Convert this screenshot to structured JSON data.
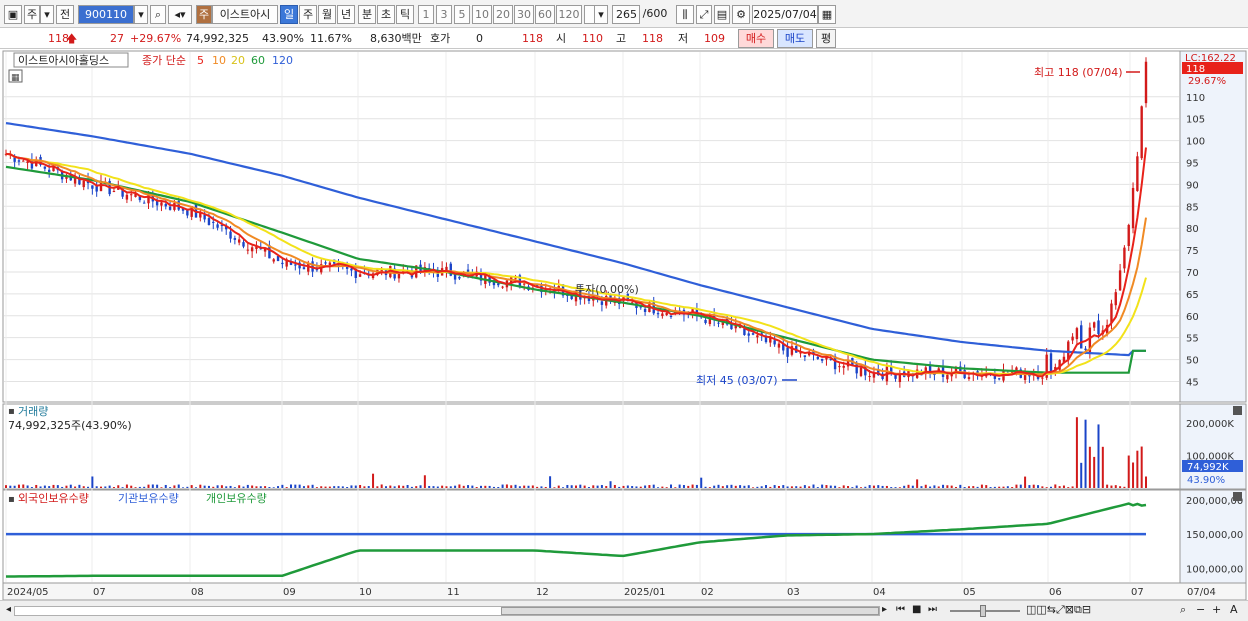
{
  "toolbar": {
    "market": "주",
    "prev_label": "전",
    "code": "900110",
    "tab_stock": "주",
    "stock_name": "이스트아시",
    "periods": [
      "일",
      "주",
      "월",
      "년",
      "분",
      "초",
      "틱"
    ],
    "active_period": "일",
    "intervals": [
      "1",
      "3",
      "5",
      "10",
      "20",
      "30",
      "60",
      "120"
    ],
    "bar_count": "265",
    "bar_total": "/600",
    "date": "2025/07/04"
  },
  "quote": {
    "price": "118",
    "change": "27",
    "change_pct": "+29.67%",
    "volume": "74,992,325",
    "vol_ratio": "43.90%",
    "turnover": "11.67%",
    "amount": "8,630백만",
    "hoga_label": "호가",
    "hoga_value": "0",
    "ask": "118",
    "open_label": "시",
    "open": "110",
    "high_label": "고",
    "high": "118",
    "low_label": "저",
    "low": "109",
    "buy_label": "매수",
    "sell_label": "매도",
    "avg_label": "평"
  },
  "colors": {
    "up": "#d21a1a",
    "down": "#1a44c8",
    "ma5": "#e8221a",
    "ma10": "#f08a24",
    "ma20": "#f2e21a",
    "ma60": "#1f9a3a",
    "ma120": "#2f5fd8"
  },
  "price_panel": {
    "stock_label": "이스트아시아홀딩스",
    "ma_label": "종가 단순",
    "ma_periods": [
      "5",
      "10",
      "20",
      "60",
      "120"
    ],
    "high_marker": "최고 118 (07/04)",
    "low_marker": "최저 45 (03/07)",
    "zero_label": "투자(0.00%)",
    "price_tag": "118",
    "pct_tag": "29.67%",
    "lc_tag": "LC:162.22"
  },
  "volume_panel": {
    "title": "거래량",
    "value_text": "74,992,325주(43.90%)",
    "tag_value": "74,992K",
    "tag_pct": "43.90%"
  },
  "holdings_panel": {
    "legend": [
      "외국인보유수량",
      "기관보유수량",
      "개인보유수량"
    ]
  },
  "chart_data": [
    {
      "type": "line",
      "name": "price",
      "x": [
        "2024/05",
        "06",
        "07",
        "08",
        "09",
        "10",
        "11",
        "12",
        "2025/01",
        "02",
        "03",
        "04",
        "05",
        "06",
        "07"
      ],
      "close": [
        97,
        90,
        84,
        72,
        70,
        70,
        67,
        63,
        60,
        52,
        47,
        47,
        47,
        48,
        118
      ],
      "ma60": [
        94,
        91,
        86,
        79,
        73,
        70,
        66,
        63,
        60,
        55,
        50,
        48,
        47,
        47,
        52
      ],
      "ma120": [
        104,
        101,
        97,
        92,
        87,
        82,
        77,
        72,
        67,
        62,
        57,
        54,
        52,
        51,
        52
      ],
      "yaxis_ticks": [
        45,
        50,
        55,
        60,
        65,
        70,
        75,
        80,
        85,
        90,
        95,
        100,
        105,
        110
      ],
      "ylim": [
        41,
        120
      ],
      "high": {
        "value": 118,
        "date": "07/04"
      },
      "low": {
        "value": 45,
        "date": "03/07"
      }
    },
    {
      "type": "bar",
      "name": "volume",
      "yaxis_ticks": [
        "100,000K",
        "200,000K"
      ],
      "ylim": [
        0,
        250000
      ],
      "unit": "K",
      "spikes": [
        {
          "month": "06",
          "value": 230000
        },
        {
          "month": "07",
          "value": 170000
        }
      ]
    },
    {
      "type": "line",
      "name": "holdings",
      "yaxis_ticks": [
        "100,000,00",
        "150,000,00",
        "200,000,00"
      ],
      "ylim": [
        80,
        210
      ]
    }
  ],
  "xaxis_labels": [
    "2024/05",
    "07",
    "08",
    "09",
    "10",
    "11",
    "12",
    "2025/01",
    "02",
    "03",
    "04",
    "05",
    "06",
    "07",
    "07/04"
  ]
}
